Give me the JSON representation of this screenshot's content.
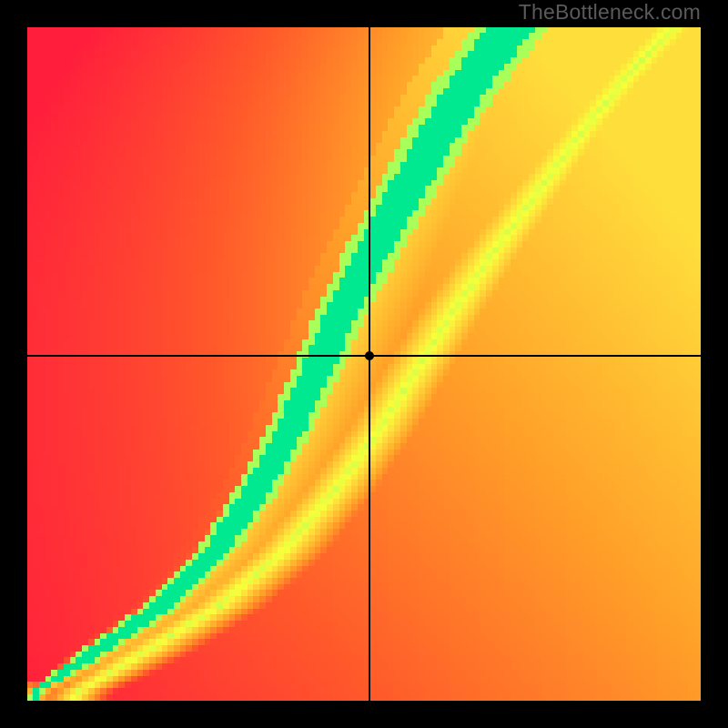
{
  "watermark": "TheBottleneck.com",
  "chart_data": {
    "type": "heatmap",
    "title": "",
    "xlabel": "",
    "ylabel": "",
    "xlim": [
      0,
      100
    ],
    "ylim": [
      0,
      100
    ],
    "grid": false,
    "legend": false,
    "crosshair": {
      "x": 50.8,
      "y": 51.2
    },
    "marker": {
      "x": 50.8,
      "y": 51.2
    },
    "optimal_band": {
      "description": "green optimal-performance ridge; rest is graded from red (bad) through orange/yellow (ok) to green (optimal)",
      "points_xy": [
        [
          1,
          1
        ],
        [
          10,
          7
        ],
        [
          20,
          14
        ],
        [
          28,
          22
        ],
        [
          34,
          31
        ],
        [
          39,
          40
        ],
        [
          43,
          49
        ],
        [
          47,
          58
        ],
        [
          51,
          66
        ],
        [
          56,
          75
        ],
        [
          61,
          84
        ],
        [
          66,
          92
        ],
        [
          72,
          100
        ]
      ],
      "band_half_width_x": [
        1.2,
        3.5,
        4.0,
        4.3,
        4.6,
        4.9,
        5.2,
        5.6,
        6.0,
        6.4,
        6.9,
        7.4,
        8.0
      ]
    },
    "color_scale": {
      "stops": [
        {
          "t": 0.0,
          "hex": "#ff1e3c"
        },
        {
          "t": 0.25,
          "hex": "#ff5a2a"
        },
        {
          "t": 0.5,
          "hex": "#ffa028"
        },
        {
          "t": 0.72,
          "hex": "#ffd83a"
        },
        {
          "t": 0.86,
          "hex": "#f7ff3a"
        },
        {
          "t": 0.94,
          "hex": "#a8ff5a"
        },
        {
          "t": 1.0,
          "hex": "#00e890"
        }
      ]
    },
    "resolution_cells": 110
  }
}
